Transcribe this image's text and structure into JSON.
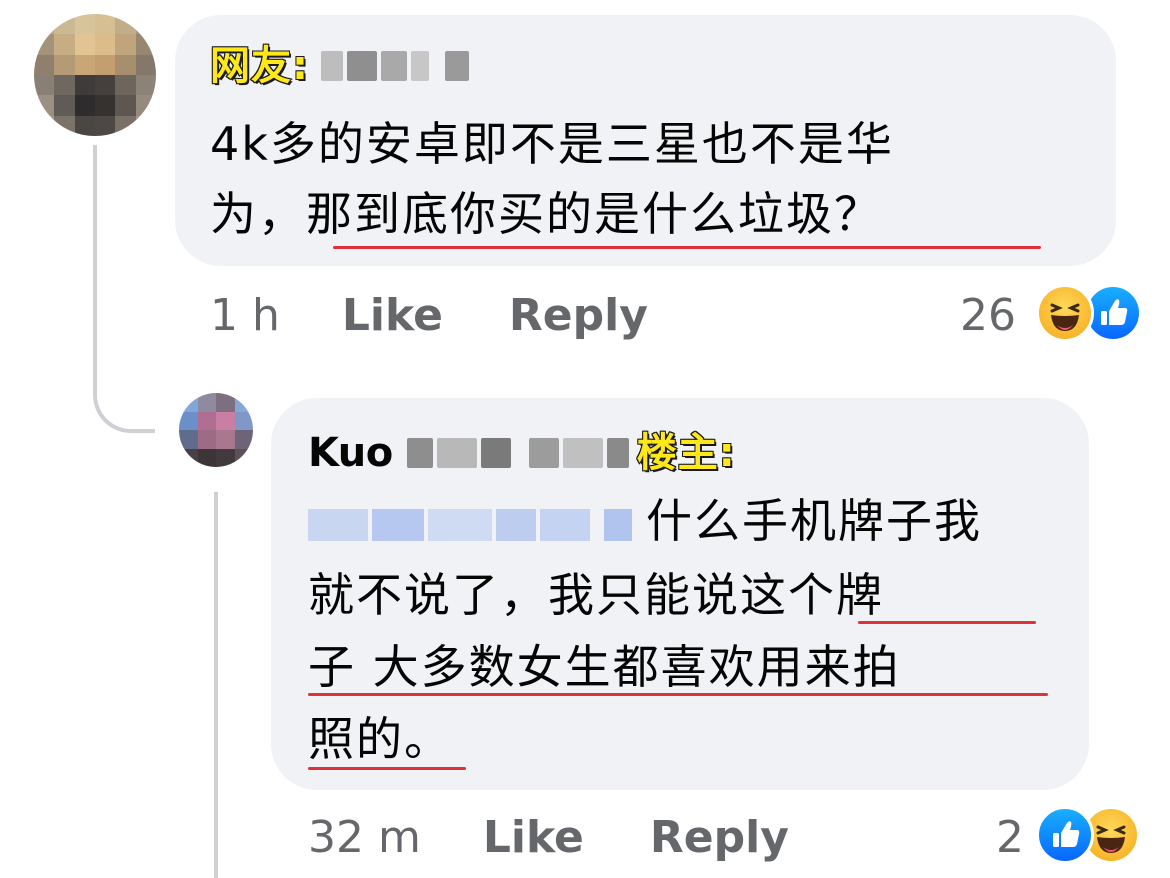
{
  "comment1": {
    "tag": "网友:",
    "author_name_blurred": "Chan Wei B",
    "text_line1": "4k多的安卓即不是三星也不是华",
    "text_line2_part1": "为，",
    "text_line2_part2": "那到底你买的是什么垃圾？",
    "time": "1 h",
    "like_label": "Like",
    "reply_label": "Reply",
    "reaction_count": "26",
    "reactions": [
      "haha-icon",
      "like-icon"
    ]
  },
  "comment2": {
    "author_first": "Kuo",
    "author_rest_blurred": "Ming Feng",
    "tag": "楼主:",
    "mention_blurred": "Chan Wei B",
    "text_line1": "什么手机牌子我",
    "text_line2_part1": "就不说了，我只能说",
    "text_line2_part2": "这个牌",
    "text_line3": "子 大多数女生都喜欢用来拍",
    "text_line4": "照的。",
    "time": "32 m",
    "like_label": "Like",
    "reply_label": "Reply",
    "reaction_count": "2",
    "reactions": [
      "like-icon",
      "haha-icon"
    ]
  },
  "colors": {
    "bubble": "#f0f2f5",
    "meta": "#65676b",
    "underline": "#e0313a",
    "tag_fill": "#ffe81a",
    "like_blue": "#0866ff"
  }
}
